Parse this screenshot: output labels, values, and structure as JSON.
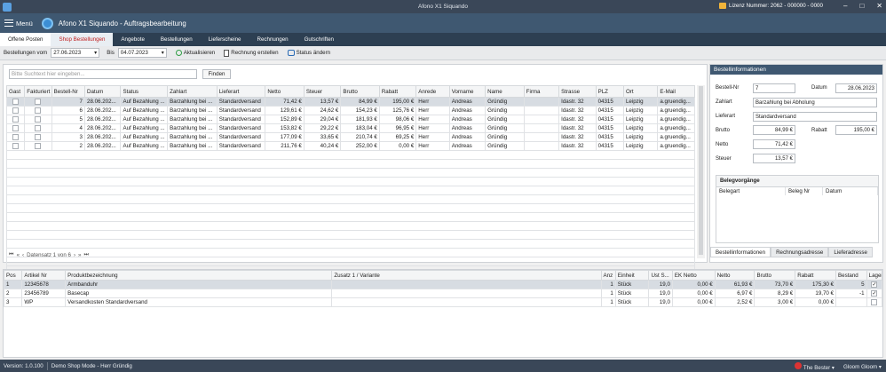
{
  "window": {
    "title": "Afono X1 Siquando",
    "license": "Lizenz Nummer: 2062 - 000000 - 0000",
    "controls": [
      "–",
      "□",
      "✕"
    ]
  },
  "header": {
    "menu_label": "Menü",
    "app_title": "Afono X1 Siquando - Auftragsbearbeitung"
  },
  "tabs": [
    "Offene Posten",
    "Shop Bestellungen",
    "Angebote",
    "Bestellungen",
    "Lieferscheine",
    "Rechnungen",
    "Gutschriften"
  ],
  "toolbar": {
    "from_label": "Bestellungen vom",
    "from_date": "27.06.2023",
    "to_label": "Bis",
    "to_date": "04.07.2023",
    "refresh": "Aktualisieren",
    "create_invoice": "Rechnung erstellen",
    "change_status": "Status ändern"
  },
  "search": {
    "placeholder": "Bitte Suchtext hier eingeben...",
    "find_button": "Finden"
  },
  "orders": {
    "columns": [
      "Gast",
      "Fakturiert",
      "Bestell-Nr",
      "Datum",
      "Status",
      "Zahlart",
      "Lieferart",
      "Netto",
      "Steuer",
      "Brutto",
      "Rabatt",
      "Anrede",
      "Vorname",
      "Name",
      "Firma",
      "Strasse",
      "PLZ",
      "Ort",
      "E-Mail"
    ],
    "rows": [
      {
        "nr": "7",
        "datum": "28.06.202...",
        "status": "Auf Bezahlung ...",
        "zahlart": "Barzahlung bei ...",
        "lieferart": "Standardversand",
        "netto": "71,42 €",
        "steuer": "13,57 €",
        "brutto": "84,99 €",
        "rabatt": "195,00 €",
        "anrede": "Herr",
        "vorname": "Andreas",
        "name": "Gründig",
        "firma": "",
        "strasse": "Idastr. 32",
        "plz": "04315",
        "ort": "Leipzig",
        "email": "a.gruendig..."
      },
      {
        "nr": "6",
        "datum": "28.06.202...",
        "status": "Auf Bezahlung ...",
        "zahlart": "Barzahlung bei ...",
        "lieferart": "Standardversand",
        "netto": "129,61 €",
        "steuer": "24,62 €",
        "brutto": "154,23 €",
        "rabatt": "125,76 €",
        "anrede": "Herr",
        "vorname": "Andreas",
        "name": "Gründig",
        "firma": "",
        "strasse": "Idastr. 32",
        "plz": "04315",
        "ort": "Leipzig",
        "email": "a.gruendig..."
      },
      {
        "nr": "5",
        "datum": "28.06.202...",
        "status": "Auf Bezahlung ...",
        "zahlart": "Barzahlung bei ...",
        "lieferart": "Standardversand",
        "netto": "152,89 €",
        "steuer": "29,04 €",
        "brutto": "181,93 €",
        "rabatt": "98,06 €",
        "anrede": "Herr",
        "vorname": "Andreas",
        "name": "Gründig",
        "firma": "",
        "strasse": "Idastr. 32",
        "plz": "04315",
        "ort": "Leipzig",
        "email": "a.gruendig..."
      },
      {
        "nr": "4",
        "datum": "28.06.202...",
        "status": "Auf Bezahlung ...",
        "zahlart": "Barzahlung bei ...",
        "lieferart": "Standardversand",
        "netto": "153,82 €",
        "steuer": "29,22 €",
        "brutto": "183,04 €",
        "rabatt": "96,95 €",
        "anrede": "Herr",
        "vorname": "Andreas",
        "name": "Gründig",
        "firma": "",
        "strasse": "Idastr. 32",
        "plz": "04315",
        "ort": "Leipzig",
        "email": "a.gruendig..."
      },
      {
        "nr": "3",
        "datum": "28.06.202...",
        "status": "Auf Bezahlung ...",
        "zahlart": "Barzahlung bei ...",
        "lieferart": "Standardversand",
        "netto": "177,09 €",
        "steuer": "33,65 €",
        "brutto": "210,74 €",
        "rabatt": "69,25 €",
        "anrede": "Herr",
        "vorname": "Andreas",
        "name": "Gründig",
        "firma": "",
        "strasse": "Idastr. 32",
        "plz": "04315",
        "ort": "Leipzig",
        "email": "a.gruendig..."
      },
      {
        "nr": "2",
        "datum": "28.06.202...",
        "status": "Auf Bezahlung ...",
        "zahlart": "Barzahlung bei ...",
        "lieferart": "Standardversand",
        "netto": "211,76 €",
        "steuer": "40,24 €",
        "brutto": "252,00 €",
        "rabatt": "0,00 €",
        "anrede": "Herr",
        "vorname": "Andreas",
        "name": "Gründig",
        "firma": "",
        "strasse": "Idastr. 32",
        "plz": "04315",
        "ort": "Leipzig",
        "email": "a.gruendig..."
      }
    ],
    "navigator": "Datensatz 1 von 6"
  },
  "details": {
    "title": "Bestellinformationen",
    "bestellnr_label": "Bestell-Nr",
    "bestellnr": "7",
    "datum_label": "Datum",
    "datum": "28.06.2023",
    "zahlart_label": "Zahlart",
    "zahlart": "Barzahlung bei Abholung",
    "lieferart_label": "Lieferart",
    "lieferart": "Standardversand",
    "brutto_label": "Brutto",
    "brutto": "84,99 €",
    "rabatt_label": "Rabatt",
    "rabatt": "195,00 €",
    "netto_label": "Netto",
    "netto": "71,42 €",
    "steuer_label": "Steuer",
    "steuer": "13,57 €",
    "belegvorgaenge": {
      "title": "Belegvorgänge",
      "columns": [
        "Belegart",
        "Beleg Nr",
        "Datum"
      ]
    },
    "tabs": [
      "Bestellinformationen",
      "Rechnungsadresse",
      "Lieferadresse"
    ]
  },
  "items": {
    "columns": [
      "Pos",
      "Artikel Nr",
      "Produktbezeichnung",
      "Zusatz 1 / Variante",
      "Anz",
      "Einheit",
      "Ust S...",
      "EK Netto",
      "Netto",
      "Brutto",
      "Rabatt",
      "Bestand",
      "Lager"
    ],
    "rows": [
      {
        "pos": "1",
        "artnr": "12345678",
        "bez": "Armbanduhr",
        "zusatz": "",
        "anz": "1",
        "einheit": "Stück",
        "ust": "19,0",
        "ek": "0,00 €",
        "netto": "61,93 €",
        "brutto": "73,70 €",
        "rabatt": "175,30 €",
        "bestand": "5",
        "lager": "✓"
      },
      {
        "pos": "2",
        "artnr": "23456789",
        "bez": "Basecap",
        "zusatz": "",
        "anz": "1",
        "einheit": "Stück",
        "ust": "19,0",
        "ek": "0,00 €",
        "netto": "6,97 €",
        "brutto": "8,29 €",
        "rabatt": "19,70 €",
        "bestand": "-1",
        "lager": "✓"
      },
      {
        "pos": "3",
        "artnr": "WP",
        "bez": "Versandkosten Standardversand",
        "zusatz": "",
        "anz": "1",
        "einheit": "Stück",
        "ust": "19,0",
        "ek": "0,00 €",
        "netto": "2,52 €",
        "brutto": "3,00 €",
        "rabatt": "0,00 €",
        "bestand": "",
        "lager": ""
      }
    ]
  },
  "statusbar": {
    "version": "Version: 1.0.100",
    "mode": "Demo Shop Mode - Herr Gründig",
    "beta": "The Bester",
    "user": "Gloom Gloom"
  }
}
